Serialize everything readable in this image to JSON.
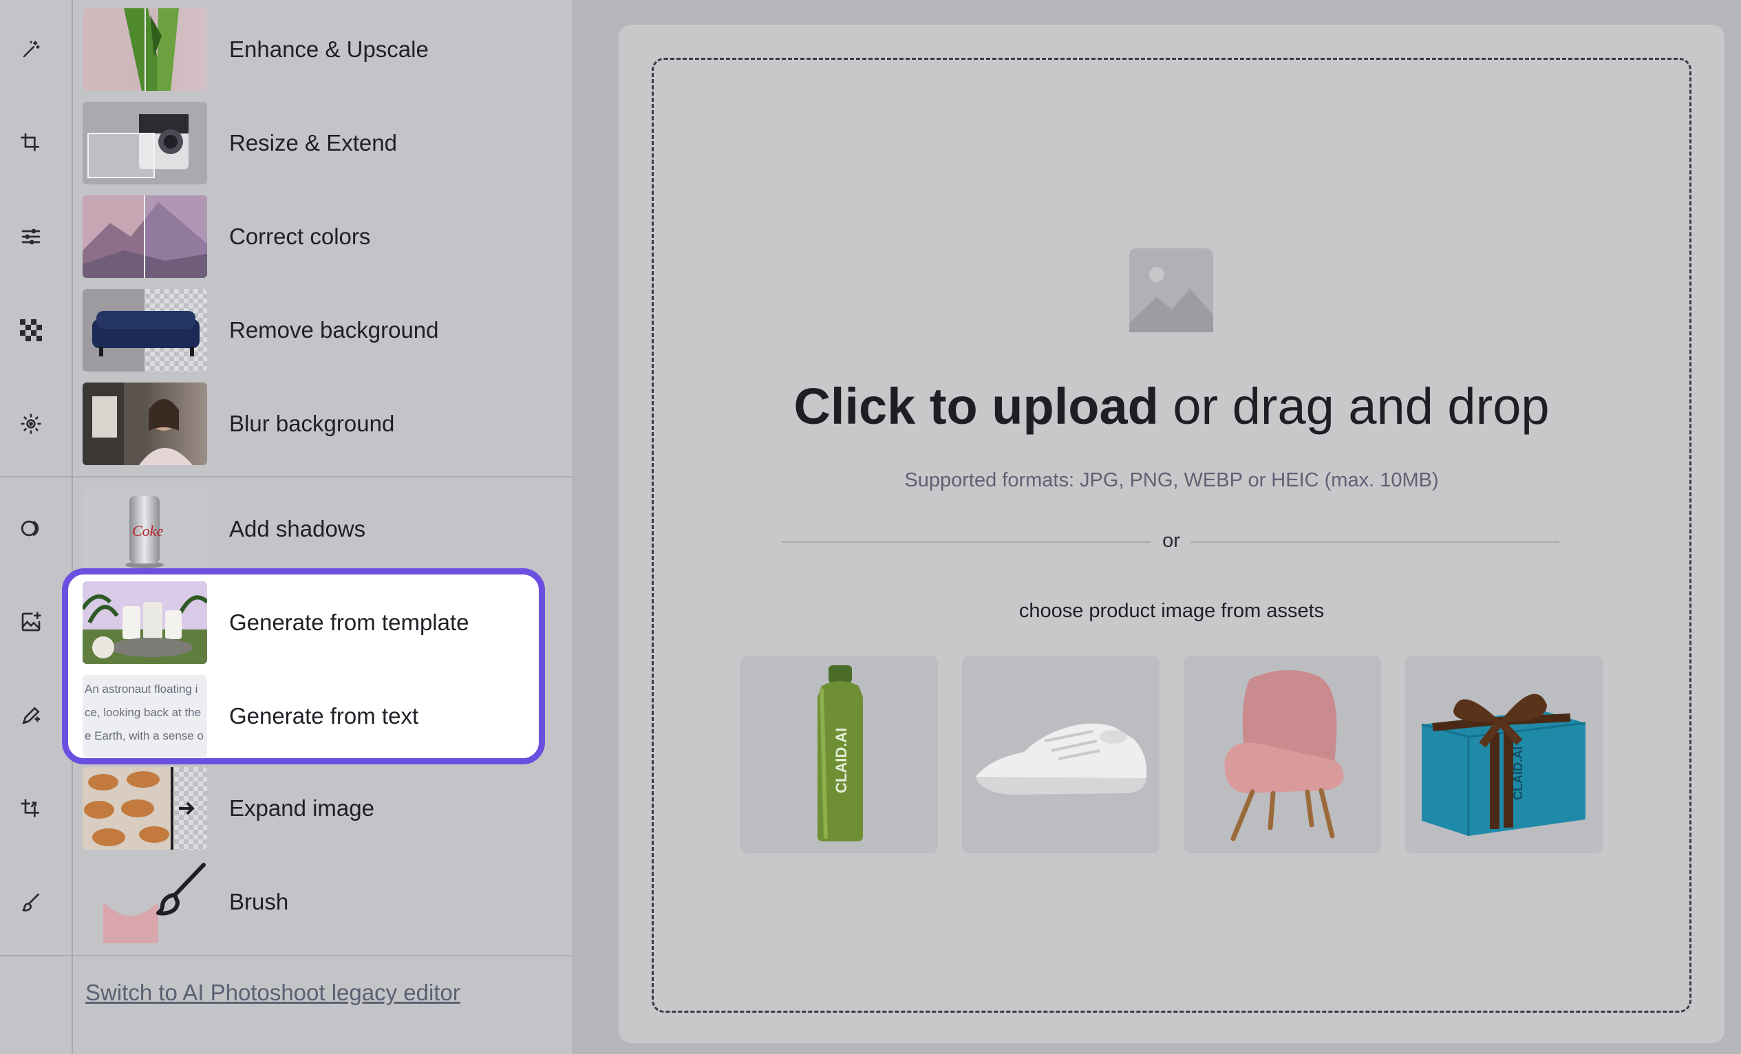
{
  "rail": {
    "icons": [
      "magic-wand-icon",
      "crop-icon",
      "sliders-icon",
      "checkerboard-icon",
      "blur-icon",
      "shadow-icon",
      "image-plus-icon",
      "pen-sparkle-icon",
      "expand-crop-icon",
      "brush-icon"
    ]
  },
  "tools": [
    {
      "label": "Enhance & Upscale"
    },
    {
      "label": "Resize & Extend"
    },
    {
      "label": "Correct colors"
    },
    {
      "label": "Remove background"
    },
    {
      "label": "Blur background"
    },
    {
      "label": "Add shadows"
    },
    {
      "label": "Generate from template"
    },
    {
      "label": "Generate from text",
      "thumb_text": [
        "An astronaut floating i",
        "ce, looking back at the",
        "e Earth, with a sense o"
      ]
    },
    {
      "label": "Expand image"
    },
    {
      "label": "Brush"
    }
  ],
  "legacy_link": "Switch to AI Photoshoot legacy editor",
  "upload": {
    "headline_bold": "Click to upload",
    "headline_rest": " or drag and drop",
    "formats": "Supported formats: JPG, PNG, WEBP or HEIC (max. 10MB)",
    "or": "or",
    "choose": "choose product image from assets",
    "bottle_text": "CLAID.AI",
    "box_text": "CLAID.AI"
  },
  "colors": {
    "accent": "#6b4fe0"
  }
}
